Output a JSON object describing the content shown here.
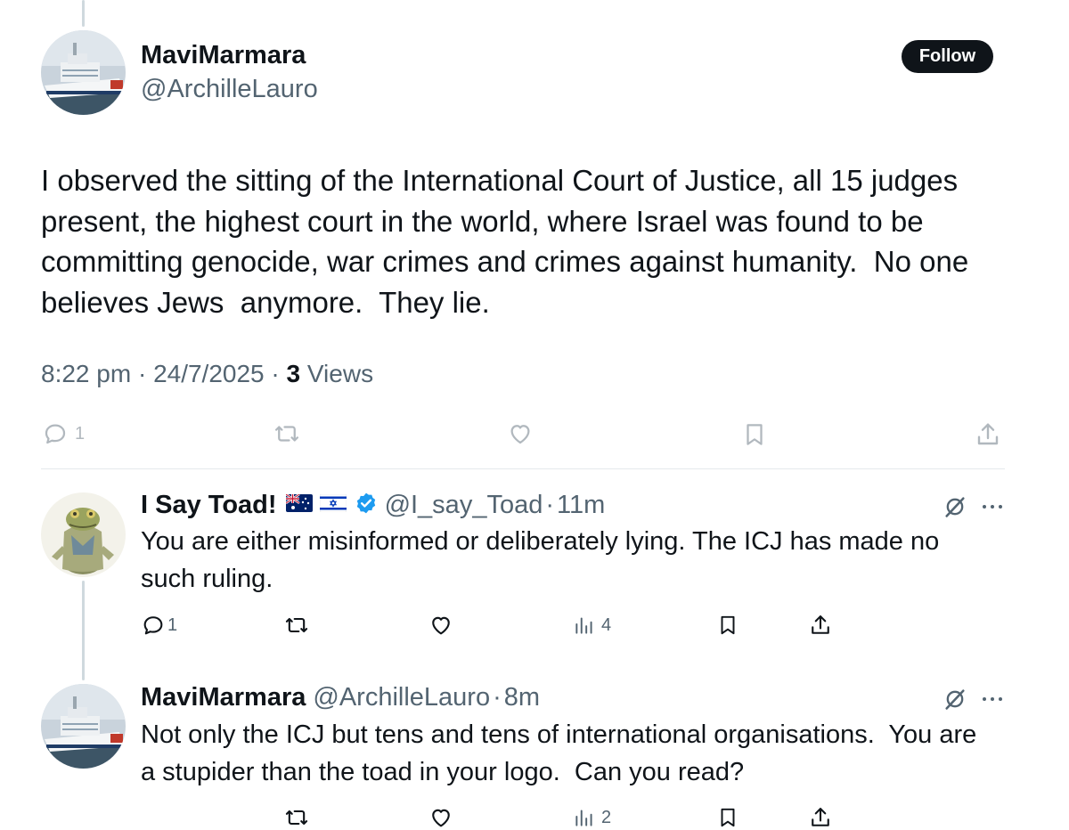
{
  "main_tweet": {
    "display_name": "MaviMarmara",
    "handle": "@ArchilleLauro",
    "follow_label": "Follow",
    "text": "I observed the sitting of the International Court of Justice, all 15 judges present, the highest court in the world, where Israel was found to be committing genocide, war crimes and crimes against humanity.  No one believes Jews  anymore.  They lie.",
    "time": "8:22 pm",
    "date": "24/7/2025",
    "separator": "·",
    "views_count": "3",
    "views_label": "Views",
    "reply_count": "1"
  },
  "replies": [
    {
      "display_name": "I Say Toad!",
      "handle": "@I_say_Toad",
      "time_ago": "11m",
      "separator": "·",
      "flags": [
        "australia-flag",
        "israel-flag"
      ],
      "verified": true,
      "text": "You are either misinformed or deliberately lying. The ICJ has made no such ruling.",
      "reply_count": "1",
      "views_count": "4"
    },
    {
      "display_name": "MaviMarmara",
      "handle": "@ArchilleLauro",
      "time_ago": "8m",
      "separator": "·",
      "text": "Not only the ICJ but tens and tens of international organisations.  You are a stupider than the toad in your logo.  Can you read?",
      "views_count": "2"
    }
  ],
  "icons": [
    "reply-icon",
    "retweet-icon",
    "like-icon",
    "bookmark-icon",
    "share-icon",
    "views-icon",
    "grok-icon",
    "more-icon",
    "verified-icon"
  ],
  "colors": {
    "text": "#0f1419",
    "secondary": "#536471",
    "verified": "#1d9bf0",
    "follow_bg": "#0f1419",
    "thread_line": "#cfd9de"
  }
}
